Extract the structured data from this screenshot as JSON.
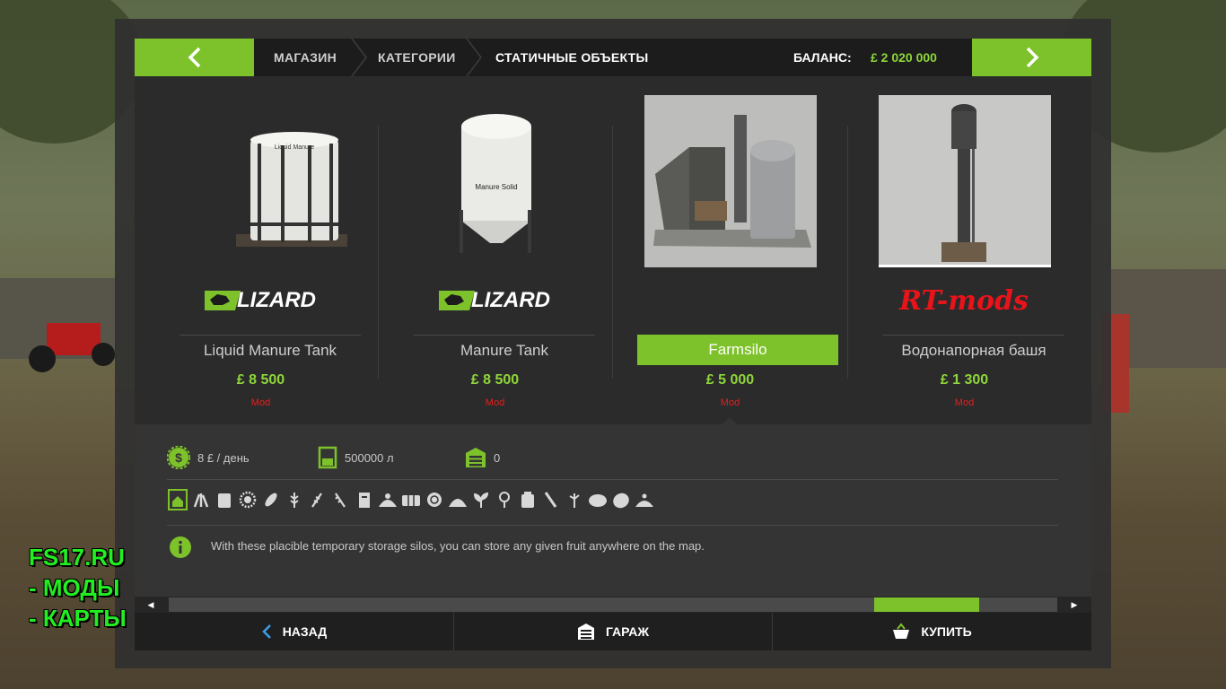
{
  "topbar": {
    "breadcrumbs": [
      "МАГАЗИН",
      "КАТЕГОРИИ",
      "СТАТИЧНЫЕ ОБЪЕКТЫ"
    ],
    "balance_label": "БАЛАНС:",
    "balance_value": "£ 2 020 000"
  },
  "items": [
    {
      "name": "Liquid Manure Tank",
      "price": "£ 8 500",
      "tag": "Mod",
      "brand": "LIZARD",
      "thumb_label": "Liquid Manure",
      "selected": false
    },
    {
      "name": "Manure Tank",
      "price": "£ 8 500",
      "tag": "Mod",
      "brand": "LIZARD",
      "thumb_label": "Manure Solid",
      "selected": false
    },
    {
      "name": "Farmsilo",
      "price": "£ 5 000",
      "tag": "Mod",
      "brand": "",
      "selected": true
    },
    {
      "name": "Водонапорная башя",
      "price": "£ 1 300",
      "tag": "Mod",
      "brand": "RT-mods",
      "selected": false
    }
  ],
  "details": {
    "cost_per_day": "8 £ / день",
    "capacity": "500000 л",
    "count": "0",
    "description": "With these placible temporary storage silos, you can store any given fruit anywhere on the map."
  },
  "bottom": {
    "back_label": "НАЗАД",
    "garage_label": "ГАРАЖ",
    "buy_label": "КУПИТЬ"
  },
  "watermark": {
    "line1": "FS17.RU",
    "line2": "- МОДЫ",
    "line3": "- КАРТЫ"
  },
  "colors": {
    "accent": "#7dc22b",
    "price": "#8ed63a",
    "mod_tag": "#e02020"
  }
}
